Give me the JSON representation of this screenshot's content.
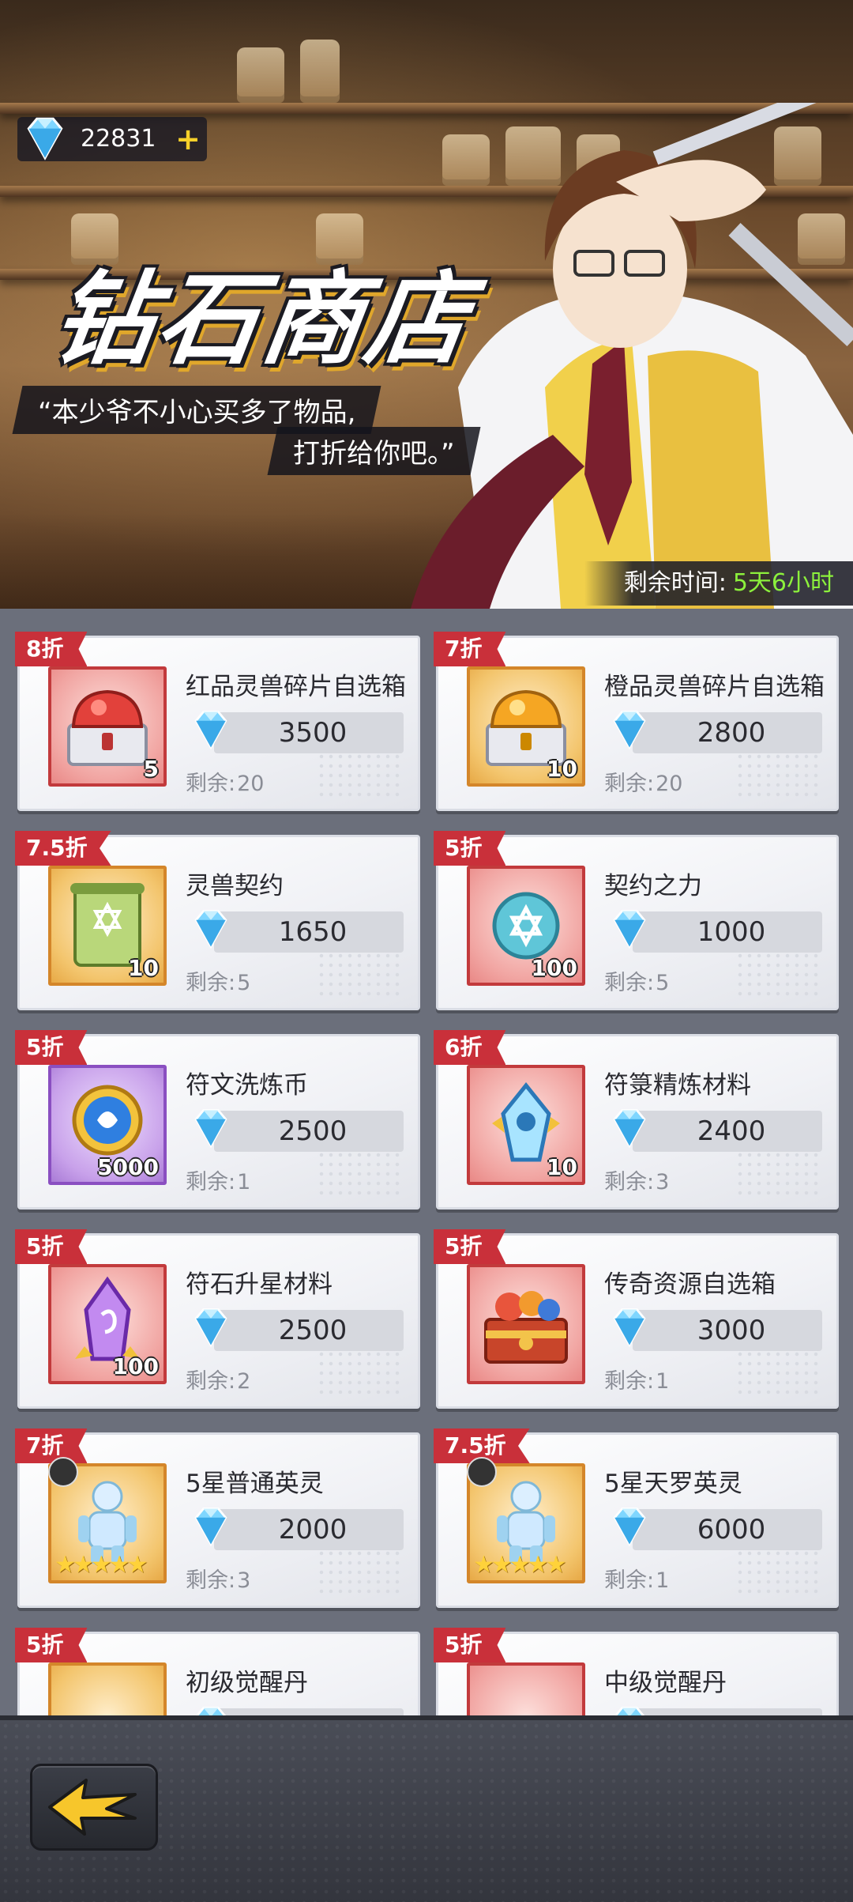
{
  "currency": {
    "amount": "22831",
    "add_icon": "plus-icon"
  },
  "banner": {
    "title": "钻石商店",
    "quote_line1": "“本少爷不小心买多了物品,",
    "quote_line2": "打折给你吧。”",
    "timer_label": "剩余时间:",
    "timer_value": "5天6小时"
  },
  "remain_label": "剩余:",
  "items": [
    {
      "discount": "8折",
      "name": "红品灵兽碎片自选箱",
      "price": "3500",
      "remain": "20",
      "qty": "5",
      "icon": "red-chest-icon",
      "frame": "red"
    },
    {
      "discount": "7折",
      "name": "橙品灵兽碎片自选箱",
      "price": "2800",
      "remain": "20",
      "qty": "10",
      "icon": "orange-chest-icon",
      "frame": "orange"
    },
    {
      "discount": "7.5折",
      "name": "灵兽契约",
      "price": "1650",
      "remain": "5",
      "qty": "10",
      "icon": "scroll-icon",
      "frame": "orange"
    },
    {
      "discount": "5折",
      "name": "契约之力",
      "price": "1000",
      "remain": "5",
      "qty": "100",
      "icon": "star-orb-icon",
      "frame": "red"
    },
    {
      "discount": "5折",
      "name": "符文洗炼币",
      "price": "2500",
      "remain": "1",
      "qty": "5000",
      "icon": "rune-coin-icon",
      "frame": "purple"
    },
    {
      "discount": "6折",
      "name": "符箓精炼材料",
      "price": "2400",
      "remain": "3",
      "qty": "10",
      "icon": "blue-crystal-icon",
      "frame": "red"
    },
    {
      "discount": "5折",
      "name": "符石升星材料",
      "price": "2500",
      "remain": "2",
      "qty": "100",
      "icon": "purple-crystal-icon",
      "frame": "red"
    },
    {
      "discount": "5折",
      "name": "传奇资源自选箱",
      "price": "3000",
      "remain": "1",
      "qty": "",
      "icon": "treasure-chest-icon",
      "frame": "red"
    },
    {
      "discount": "7折",
      "name": "5星普通英灵",
      "price": "2000",
      "remain": "3",
      "qty": "",
      "icon": "hero-spirit-icon",
      "frame": "orange",
      "stars": "★★★★★"
    },
    {
      "discount": "7.5折",
      "name": "5星天罗英灵",
      "price": "6000",
      "remain": "1",
      "qty": "",
      "icon": "hero-spirit-icon",
      "frame": "orange",
      "stars": "★★★★★"
    },
    {
      "discount": "5折",
      "name": "初级觉醒丹",
      "price": "",
      "remain": "",
      "qty": "",
      "icon": "blue-pill-icon",
      "frame": "orange"
    },
    {
      "discount": "5折",
      "name": "中级觉醒丹",
      "price": "",
      "remain": "",
      "qty": "",
      "icon": "purple-pill-icon",
      "frame": "red"
    }
  ],
  "footer": {
    "back_icon": "back-arrow-icon"
  },
  "colors": {
    "discount_ribbon": "#c9303a",
    "timer_value": "#8cf03c",
    "plus": "#f6d02a"
  }
}
